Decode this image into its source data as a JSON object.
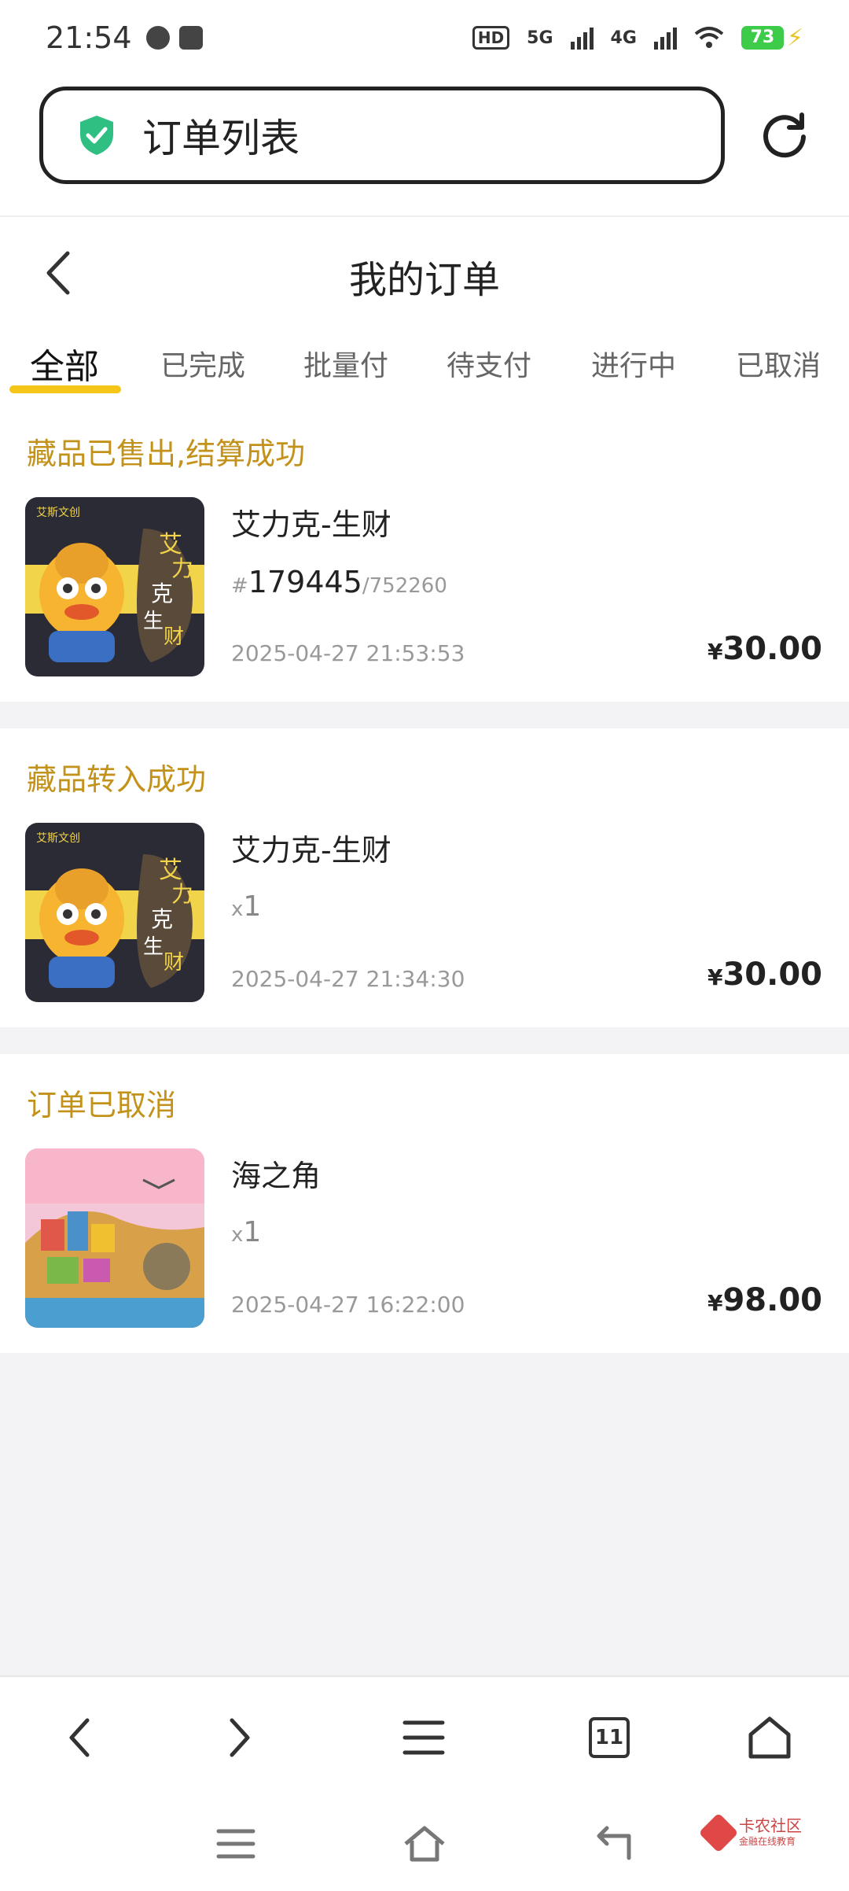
{
  "status_bar": {
    "time": "21:54",
    "hd": "HD",
    "net1": "5G",
    "net2": "4G",
    "battery": "73"
  },
  "address_bar": {
    "title": "订单列表"
  },
  "header": {
    "title": "我的订单"
  },
  "tabs": [
    {
      "label": "全部",
      "active": true
    },
    {
      "label": "已完成"
    },
    {
      "label": "批量付"
    },
    {
      "label": "待支付"
    },
    {
      "label": "进行中"
    },
    {
      "label": "已取消"
    }
  ],
  "orders": [
    {
      "status": "藏品已售出,结算成功",
      "name": "艾力克-生财",
      "serial_prefix": "#",
      "serial": "179445",
      "total": "/752260",
      "time": "2025-04-27 21:53:53",
      "currency": "¥",
      "price": "30.00"
    },
    {
      "status": "藏品转入成功",
      "name": "艾力克-生财",
      "qty_prefix": "x",
      "qty": "1",
      "time": "2025-04-27 21:34:30",
      "currency": "¥",
      "price": "30.00"
    },
    {
      "status": "订单已取消",
      "name": "海之角",
      "qty_prefix": "x",
      "qty": "1",
      "time": "2025-04-27 16:22:00",
      "currency": "¥",
      "price": "98.00"
    }
  ],
  "browser_bar": {
    "tab_count": "11"
  },
  "watermark": {
    "title": "卡农社区",
    "subtitle": "金融在线教育"
  },
  "colors": {
    "accent": "#f5c519",
    "status_text": "#c3921a",
    "shield": "#2fbf83"
  }
}
